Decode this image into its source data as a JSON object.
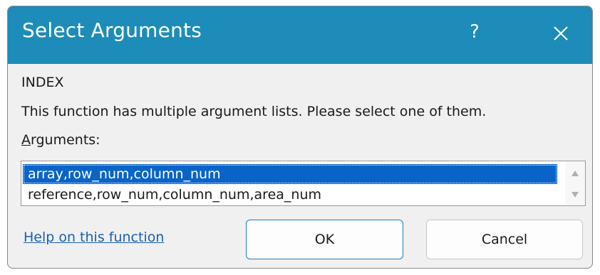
{
  "dialog": {
    "title": "Select Arguments",
    "help_glyph": "?",
    "close_icon": "close-icon",
    "accent_color": "#1d8cb8"
  },
  "content": {
    "function_name": "INDEX",
    "description": "This function has multiple argument lists.  Please select one of them.",
    "arguments_label_access": "A",
    "arguments_label_rest": "rguments:"
  },
  "arguments_list": {
    "items": [
      {
        "label": "array,row_num,column_num",
        "selected": true
      },
      {
        "label": "reference,row_num,column_num,area_num",
        "selected": false
      }
    ]
  },
  "footer": {
    "help_link": "Help on this function",
    "ok_label": "OK",
    "cancel_label": "Cancel"
  }
}
